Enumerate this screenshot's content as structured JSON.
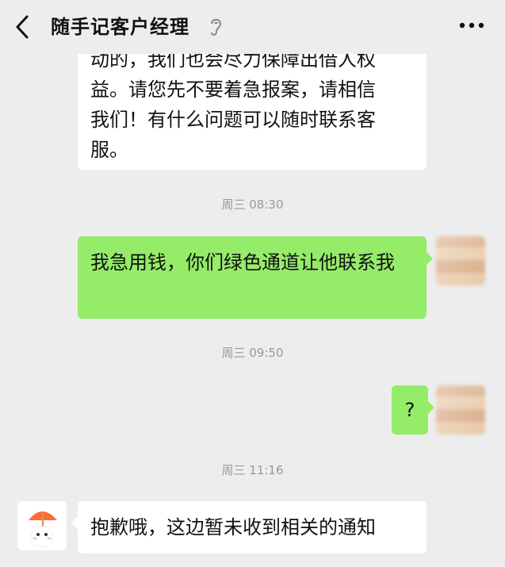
{
  "header": {
    "title": "随手记客户经理"
  },
  "messages": {
    "m1_line0": "动的，我们也会尽力保障出借人权",
    "m1_line1": "益。请您先不要着急报案，请相信",
    "m1_line2": "我们！有什么问题可以随时联系客",
    "m1_line3": "服。",
    "time1": "周三 08:30",
    "m2": "我急用钱，你们绿色通道让他联系我",
    "time2": "周三 09:50",
    "m3": "?",
    "time3": "周三 11:16",
    "m4": "抱歉哦，这边暂未收到相关的通知"
  },
  "colors": {
    "incoming": "#ffffff",
    "outgoing": "#95ec69",
    "background": "#ededed"
  },
  "icons": [
    "back-icon",
    "ear-icon",
    "more-icon"
  ]
}
